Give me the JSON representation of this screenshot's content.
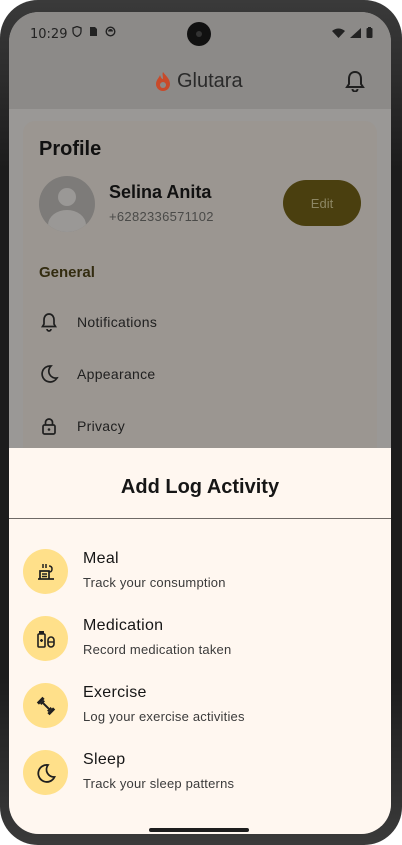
{
  "status_bar": {
    "time": "10:29"
  },
  "app_bar": {
    "brand": "Glutara"
  },
  "profile": {
    "title": "Profile",
    "name": "Selina Anita",
    "phone": "+6282336571102",
    "edit_label": "Edit",
    "general_label": "General",
    "menu": [
      {
        "label": "Notifications",
        "icon": "bell-icon"
      },
      {
        "label": "Appearance",
        "icon": "moon-icon"
      },
      {
        "label": "Privacy",
        "icon": "lock-icon"
      }
    ]
  },
  "sheet": {
    "title": "Add Log Activity",
    "items": [
      {
        "title": "Meal",
        "subtitle": "Track your consumption",
        "icon": "meal-icon"
      },
      {
        "title": "Medication",
        "subtitle": "Record medication taken",
        "icon": "medication-icon"
      },
      {
        "title": "Exercise",
        "subtitle": "Log your exercise activities",
        "icon": "dumbbell-icon"
      },
      {
        "title": "Sleep",
        "subtitle": "Track your sleep patterns",
        "icon": "moon-icon"
      }
    ]
  },
  "colors": {
    "accent": "#ffe08a",
    "sheet_bg": "#fff7f0",
    "edit_button": "#4a3f0f"
  }
}
